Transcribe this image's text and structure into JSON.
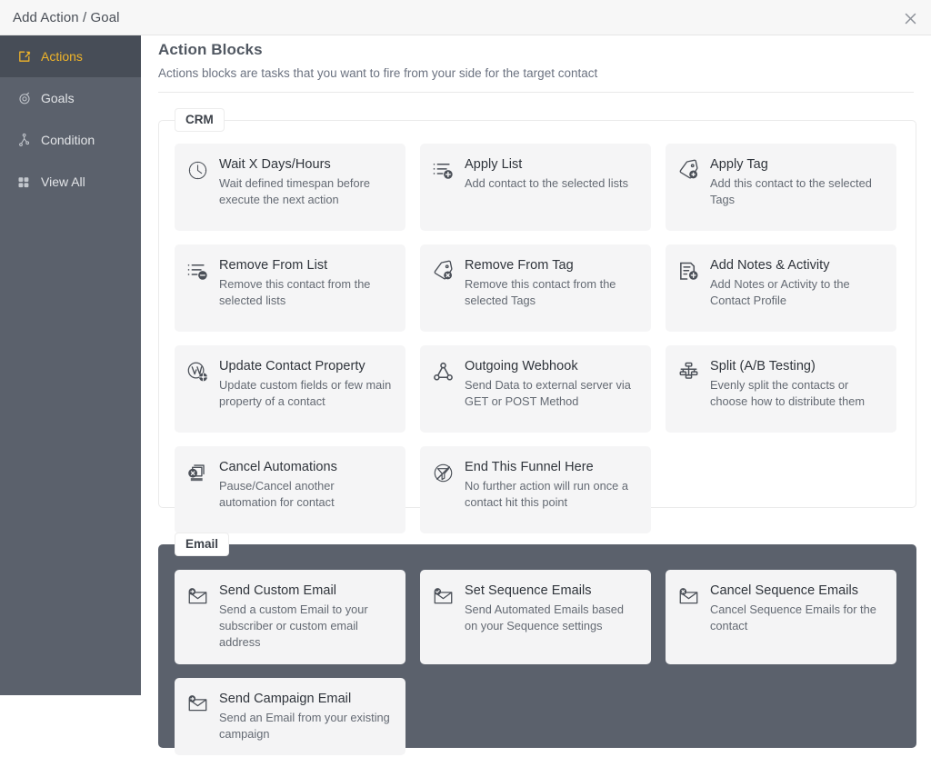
{
  "window": {
    "title": "Add Action / Goal",
    "close_icon": "close-icon"
  },
  "sidebar": {
    "items": [
      {
        "label": "Actions",
        "icon": "action-arrow-icon",
        "active": true
      },
      {
        "label": "Goals",
        "icon": "target-icon",
        "active": false
      },
      {
        "label": "Condition",
        "icon": "branch-icon",
        "active": false
      },
      {
        "label": "View All",
        "icon": "grid-icon",
        "active": false
      }
    ]
  },
  "main": {
    "title": "Action Blocks",
    "subtitle": "Actions blocks are tasks that you want to fire from your side for the target contact",
    "groups": [
      {
        "label": "CRM",
        "theme": "light",
        "cards": [
          {
            "title": "Wait X Days/Hours",
            "desc": "Wait defined timespan before execute the next action",
            "icon": "clock-icon"
          },
          {
            "title": "Apply List",
            "desc": "Add contact to the selected lists",
            "icon": "list-add-icon"
          },
          {
            "title": "Apply Tag",
            "desc": "Add this contact to the selected Tags",
            "icon": "tag-add-icon"
          },
          {
            "title": "Remove From List",
            "desc": "Remove this contact from the selected lists",
            "icon": "list-remove-icon"
          },
          {
            "title": "Remove From Tag",
            "desc": "Remove this contact from the selected Tags",
            "icon": "tag-remove-icon"
          },
          {
            "title": "Add Notes & Activity",
            "desc": "Add Notes or Activity to the Contact Profile",
            "icon": "note-add-icon"
          },
          {
            "title": "Update Contact Property",
            "desc": "Update custom fields or few main property of a contact",
            "icon": "contact-property-icon"
          },
          {
            "title": "Outgoing Webhook",
            "desc": "Send Data to external server via GET or POST Method",
            "icon": "webhook-icon"
          },
          {
            "title": "Split (A/B Testing)",
            "desc": "Evenly split the contacts or choose how to distribute them",
            "icon": "split-icon"
          },
          {
            "title": "Cancel Automations",
            "desc": "Pause/Cancel another automation for contact",
            "icon": "cancel-automation-icon"
          },
          {
            "title": "End This Funnel Here",
            "desc": "No further action will run once a contact hit this point",
            "icon": "end-funnel-icon"
          }
        ]
      },
      {
        "label": "Email",
        "theme": "dark",
        "cards": [
          {
            "title": "Send Custom Email",
            "desc": "Send a custom Email to your subscriber or custom email address",
            "icon": "mail-send-icon"
          },
          {
            "title": "Set Sequence Emails",
            "desc": "Send Automated Emails based on your Sequence settings",
            "icon": "mail-check-icon"
          },
          {
            "title": "Cancel Sequence Emails",
            "desc": "Cancel Sequence Emails for the contact",
            "icon": "mail-cancel-icon"
          },
          {
            "title": "Send Campaign Email",
            "desc": "Send an Email from your existing campaign",
            "icon": "mail-send-icon"
          }
        ]
      }
    ]
  },
  "colors": {
    "accent": "#f0b429",
    "sidebar_bg": "#5b616c",
    "sidebar_active_bg": "#474d57",
    "card_bg": "#f5f5f6",
    "title_bar_bg": "#f7f7f7"
  }
}
